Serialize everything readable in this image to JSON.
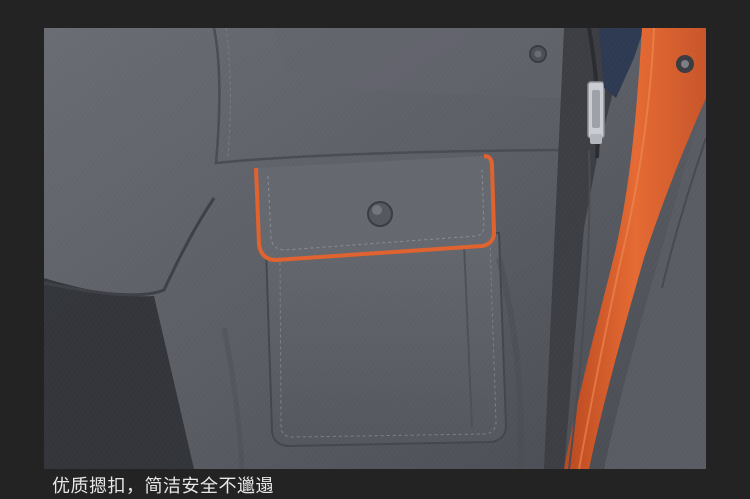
{
  "caption": {
    "text": "优质摁扣，简洁安全不邋遢"
  },
  "photo": {
    "subject": "workwear-jacket-chest-pocket",
    "colors": {
      "fabric": "#5c5e66",
      "fabric_dark": "#44464d",
      "fabric_light": "#6c6e76",
      "trim": "#e0622e",
      "trim_dark": "#b9481f",
      "zipper": "#c9ccd2",
      "background": "#232323"
    }
  }
}
